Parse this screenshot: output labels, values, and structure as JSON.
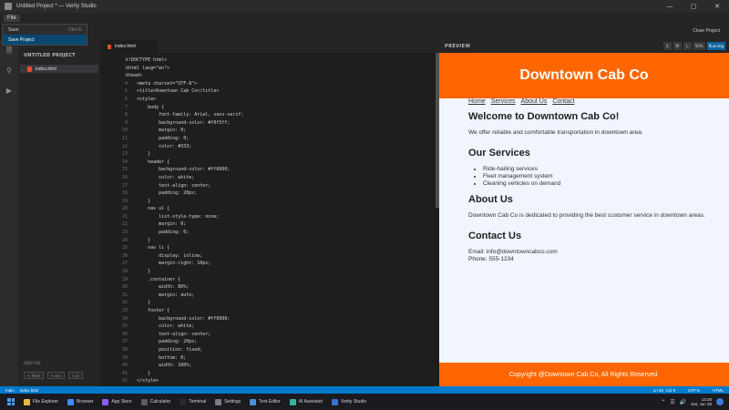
{
  "window": {
    "title": "Untitled Project * — Verity Studio",
    "controls": [
      "—",
      "▢",
      "✕"
    ]
  },
  "menu": {
    "file": "File"
  },
  "dropdown": {
    "items": [
      {
        "label": "Save",
        "shortcut": "Ctrl+S"
      },
      {
        "label": "Save Project",
        "shortcut": ""
      }
    ]
  },
  "toolbar": {
    "close_project": "Close Project"
  },
  "sidebar": {
    "title": "UNTITLED PROJECT",
    "file": "index.html",
    "add_file_label": "ADD FILE",
    "add_buttons": [
      "+.html",
      "+.css",
      "+.js"
    ]
  },
  "editor": {
    "tab": "index.html",
    "lines": [
      "<!DOCTYPE html>",
      "<html lang=\"en\">",
      "<head>",
      "    <meta charset=\"UTF-8\">",
      "    <title>Downtown Cab Co</title>",
      "    <style>",
      "        body {",
      "            font-family: Arial, sans-serif;",
      "            background-color: #f0f5ff;",
      "            margin: 0;",
      "            padding: 0;",
      "            color: #333;",
      "        }",
      "        header {",
      "            background-color: #ff6600;",
      "            color: white;",
      "            text-align: center;",
      "            padding: 20px;",
      "        }",
      "        nav ul {",
      "            list-style-type: none;",
      "            margin: 0;",
      "            padding: 0;",
      "        }",
      "        nav li {",
      "            display: inline;",
      "            margin-right: 10px;",
      "        }",
      "        .container {",
      "            width: 80%;",
      "            margin: auto;",
      "        }",
      "        footer {",
      "            background-color: #ff6600;",
      "            color: white;",
      "            text-align: center;",
      "            padding: 20px;",
      "            position: fixed;",
      "            bottom: 0;",
      "            width: 100%;",
      "        }",
      "    </style>",
      "</head>"
    ]
  },
  "preview": {
    "label": "PREVIEW",
    "controls": [
      "S",
      "M",
      "L",
      "50%",
      "Running"
    ],
    "site": {
      "header": "Downtown Cab Co",
      "nav": [
        "Home",
        "Services",
        "About Us",
        "Contact"
      ],
      "welcome_title": "Welcome to Downtown Cab Co!",
      "welcome_text": "We offer reliable and comfortable transportation in downtown area.",
      "services_title": "Our Services",
      "services": [
        "Ride-hailing services",
        "Fleet management system",
        "Cleaning vehicles on demand"
      ],
      "about_title": "About Us",
      "about_text": "Downtown Cab Co is dedicated to providing the best customer service in downtown areas.",
      "contact_title": "Contact Us",
      "contact_email": "Email: info@downtowncabco.com",
      "contact_phone": "Phone: 555-1234",
      "footer": "Copyright @Downtown Cab Co, All Rights Reserved."
    }
  },
  "statusbar": {
    "left": [
      "main",
      "index.html"
    ],
    "right": [
      "Ln 92, Col 8",
      "UTF-8",
      "HTML"
    ]
  },
  "taskbar": {
    "items": [
      {
        "label": "File Explorer",
        "color": "#e8b84a"
      },
      {
        "label": "Browser",
        "color": "#3d8bfd"
      },
      {
        "label": "App Store",
        "color": "#8a5cf6"
      },
      {
        "label": "Calculator",
        "color": "#5a5a66"
      },
      {
        "label": "Terminal",
        "color": "#2a2a2a"
      },
      {
        "label": "Settings",
        "color": "#7a7a86"
      },
      {
        "label": "Text Editor",
        "color": "#4a90d9"
      },
      {
        "label": "AI Assistant",
        "color": "#2fb5a0"
      },
      {
        "label": "Verity Studio",
        "color": "#3a6fd8"
      }
    ],
    "clock_time": "13:28",
    "clock_date": "Sat, Jun 28"
  }
}
